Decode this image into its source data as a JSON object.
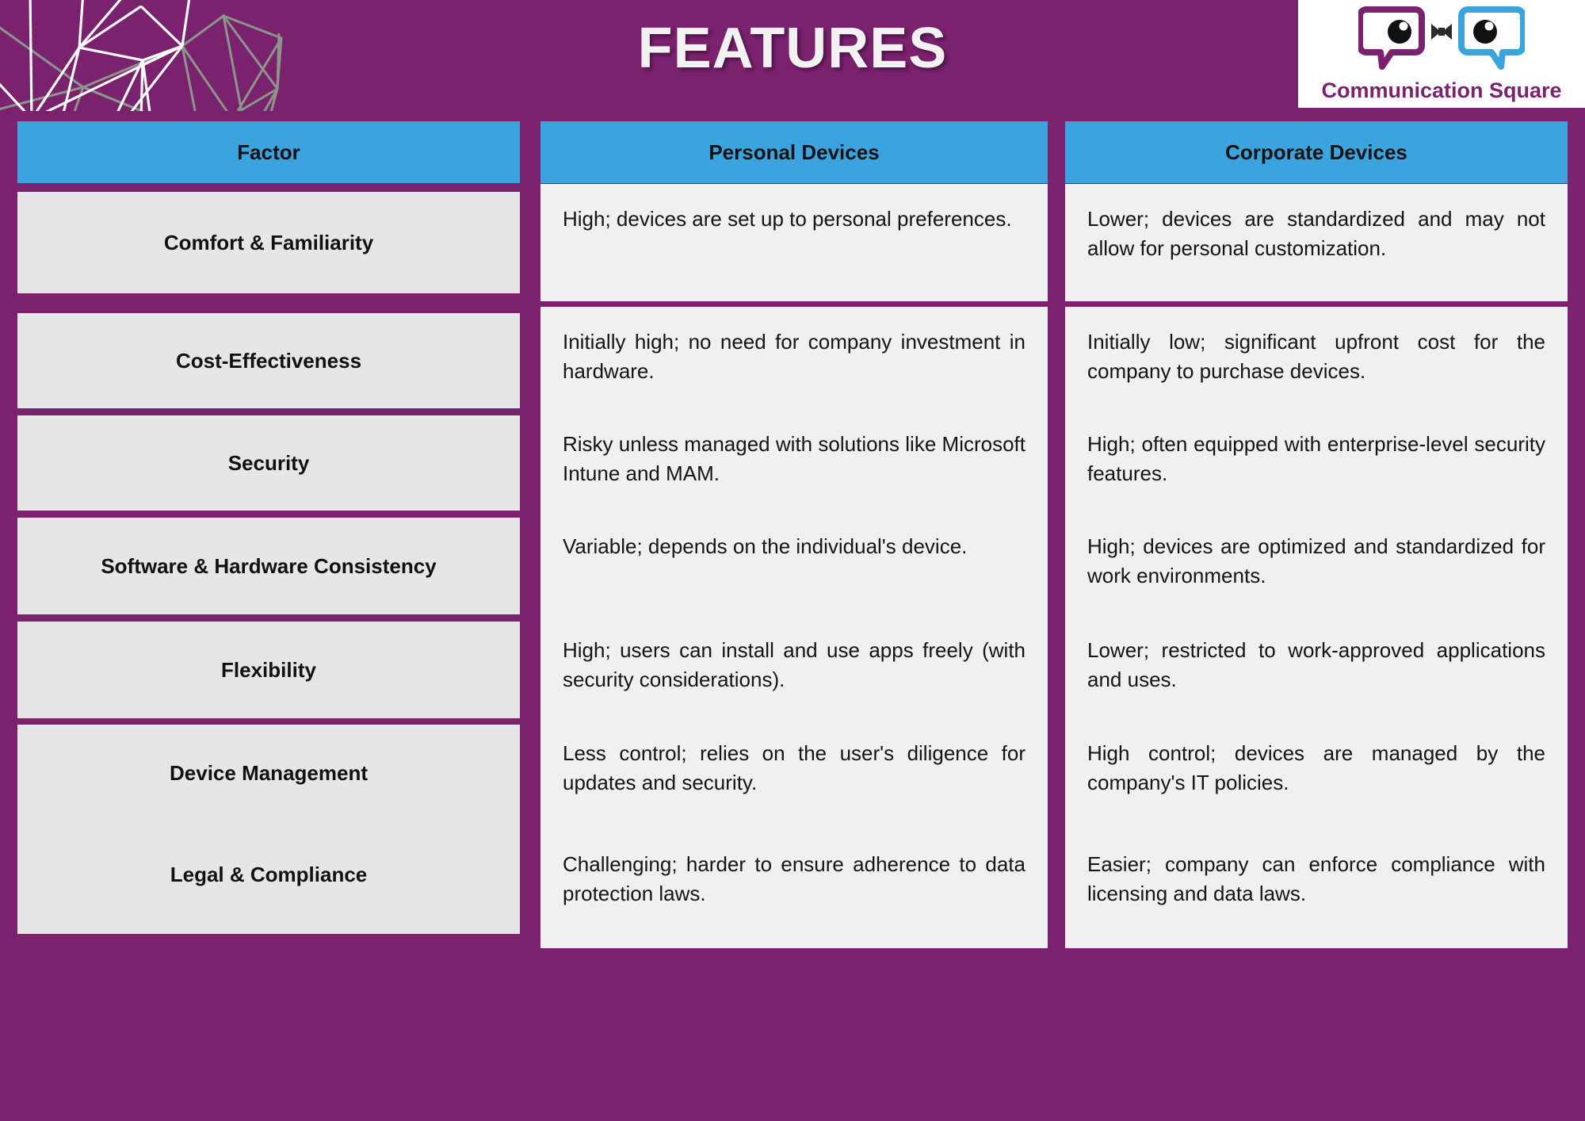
{
  "header": {
    "title": "FEATURES",
    "logo": {
      "wordmark": "Communication Square",
      "bubble_left_color": "#7a226e",
      "bubble_right_color": "#3ba3de",
      "panel_background": "#ffffff"
    },
    "background_color": "#7a226e",
    "mesh_decoration": "polygon-mesh-graphic"
  },
  "colors": {
    "purple": "#7a226e",
    "header_blue": "#3ba3de",
    "factor_gray": "#e6e6e6",
    "cell_gray": "#f0f0f0",
    "title_white": "#f2f2f2"
  },
  "table": {
    "columns": [
      "Factor",
      "Personal Devices",
      "Corporate Devices"
    ],
    "rows": [
      {
        "factor": "Comfort & Familiarity",
        "personal": "High; devices are set up to personal preferences.",
        "corporate": "Lower; devices are standardized and may not allow for personal customization."
      },
      {
        "factor": "Cost-Effectiveness",
        "personal": "Initially high; no need for company investment in hardware.",
        "corporate": "Initially low; significant upfront cost for the company to purchase devices."
      },
      {
        "factor": "Security",
        "personal": "Risky unless managed with solutions like Microsoft Intune and MAM.",
        "corporate": "High; often equipped with enterprise-level security features."
      },
      {
        "factor": "Software & Hardware Consistency",
        "personal": "Variable; depends on the individual's device.",
        "corporate": "High; devices are optimized and standardized for work environments."
      },
      {
        "factor": "Flexibility",
        "personal": "High; users can install and use apps freely (with security considerations).",
        "corporate": "Lower; restricted to work-approved applications and uses."
      },
      {
        "factor": "Device Management",
        "personal": "Less control; relies on the user's diligence for updates and security.",
        "corporate": "High control; devices are managed by the company's IT policies."
      },
      {
        "factor": "Legal & Compliance",
        "personal": "Challenging; harder to ensure adherence to data protection laws.",
        "corporate": "Easier; company can enforce compliance with licensing and data laws."
      }
    ]
  }
}
